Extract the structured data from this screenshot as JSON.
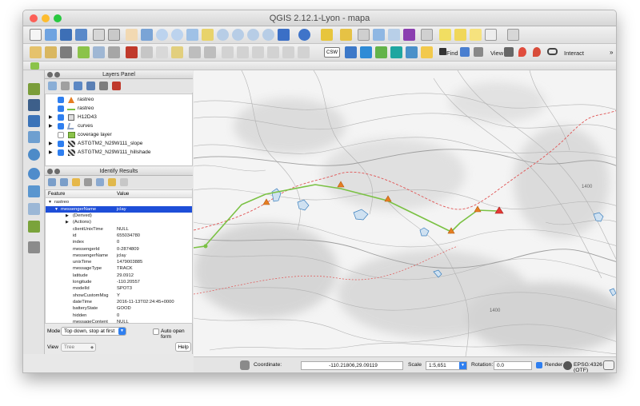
{
  "window": {
    "title": "QGIS 2.12.1-Lyon - mapa"
  },
  "toolbar": {
    "find_label": "Find",
    "view_label": "View",
    "interact_label": "Interact",
    "csw_label": "CSW"
  },
  "layers_panel": {
    "title": "Layers Panel",
    "layers": [
      {
        "name": "rastreo",
        "checked": true,
        "icon": "triangle-point-icon"
      },
      {
        "name": "rastreo",
        "checked": true,
        "icon": "line-icon"
      },
      {
        "name": "H12D43",
        "checked": true,
        "icon": "raster-icon"
      },
      {
        "name": "curves",
        "checked": true,
        "icon": "contour-icon"
      },
      {
        "name": "coverage layer",
        "checked": false,
        "icon": "polygon-icon"
      },
      {
        "name": "ASTGTM2_N29W111_slope",
        "checked": true,
        "icon": "raster-icon"
      },
      {
        "name": "ASTGTM2_N29W111_hillshade",
        "checked": true,
        "icon": "raster-icon"
      }
    ]
  },
  "identify": {
    "title": "Identify Results",
    "col_feature": "Feature",
    "col_value": "Value",
    "root": "rastreo",
    "selected_key": "messengerName",
    "selected_value": "jclay",
    "groups": [
      "(Derived)",
      "(Actions)"
    ],
    "attributes": [
      {
        "k": "clientUnixTime",
        "v": "NULL"
      },
      {
        "k": "id",
        "v": "655034780"
      },
      {
        "k": "index",
        "v": "0"
      },
      {
        "k": "messengerId",
        "v": "0-2874809"
      },
      {
        "k": "messengerName",
        "v": "jclay"
      },
      {
        "k": "unixTime",
        "v": "1479003885"
      },
      {
        "k": "messageType",
        "v": "TRACK"
      },
      {
        "k": "latitude",
        "v": "29.0912"
      },
      {
        "k": "longitude",
        "v": "-110.20557"
      },
      {
        "k": "modelId",
        "v": "SPOT3"
      },
      {
        "k": "showCustomMsg",
        "v": "Y"
      },
      {
        "k": "dateTime",
        "v": "2016-11-13T02:24:45+0000"
      },
      {
        "k": "batteryState",
        "v": "GOOD"
      },
      {
        "k": "hidden",
        "v": "0"
      },
      {
        "k": "messageContent",
        "v": "NULL"
      }
    ],
    "mode_label": "Mode",
    "mode_value": "Top down, stop at first",
    "auto_open_label": "Auto open form",
    "view_label": "View",
    "view_value": "Tree",
    "help_label": "Help"
  },
  "map": {
    "contour_label_1": "1400",
    "contour_label_2": "1400"
  },
  "status": {
    "coordinate_label": "Coordinate:",
    "coordinate_value": "-110.21806,29.09119",
    "scale_label": "Scale",
    "scale_value": "1:5,651",
    "rotation_label": "Rotation:",
    "rotation_value": "0.0",
    "render_label": "Render",
    "crs_label": "EPSG:4326 (OTF)"
  },
  "colors": {
    "selection": "#1e4ed8",
    "track_line": "#7ac143",
    "point_fill": "#e67e22",
    "point_last": "#e53935"
  }
}
